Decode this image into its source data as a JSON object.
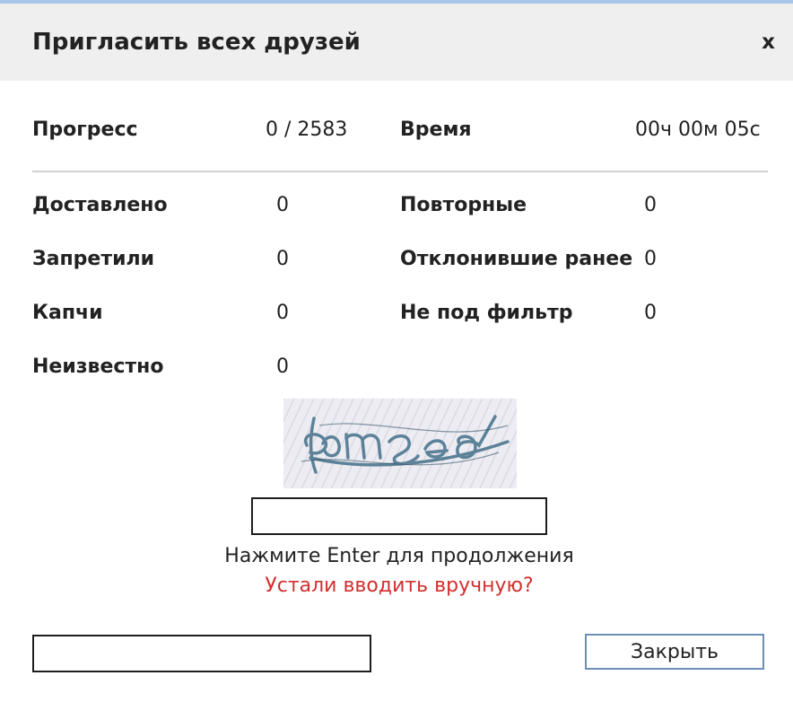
{
  "dialog": {
    "title": "Пригласить всех друзей",
    "close_symbol": "x"
  },
  "progress": {
    "label": "Прогресс",
    "value": "0 / 2583"
  },
  "time": {
    "label": "Время",
    "value": "00ч 00м 05с"
  },
  "stats": {
    "left": [
      {
        "label": "Доставлено",
        "value": "0"
      },
      {
        "label": "Запретили",
        "value": "0"
      },
      {
        "label": "Капчи",
        "value": "0"
      },
      {
        "label": "Неизвестно",
        "value": "0"
      }
    ],
    "right": [
      {
        "label": "Повторные",
        "value": "0"
      },
      {
        "label": "Отклонившие ранее",
        "value": "0"
      },
      {
        "label": "Не под фильтр",
        "value": "0"
      }
    ]
  },
  "captcha": {
    "input_value": "",
    "hint": "Нажмите Enter для продолжения",
    "tired_link": "Устали вводить вручную?"
  },
  "footer": {
    "input_value": "",
    "close_button": "Закрыть"
  },
  "colors": {
    "header_bg": "#efeff0",
    "link_red": "#d32f2f",
    "button_border": "#6d8fb6"
  }
}
